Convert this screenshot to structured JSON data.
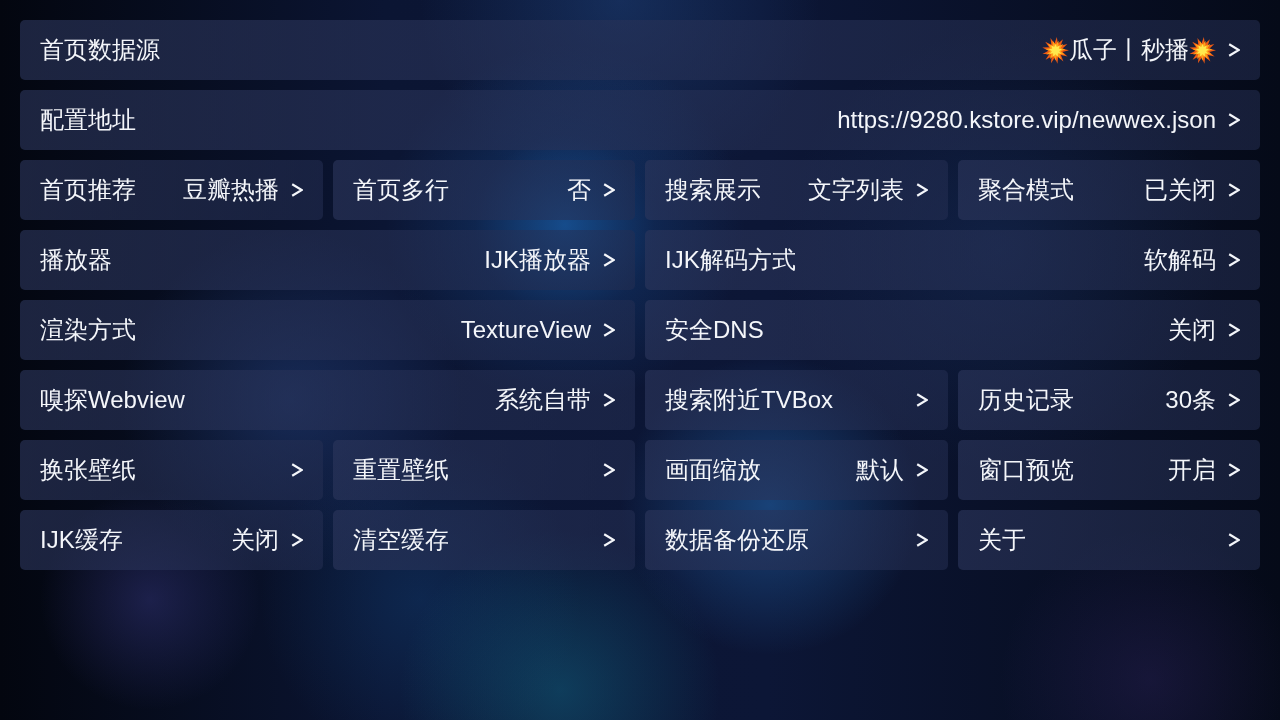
{
  "settings": [
    {
      "label": "首页数据源",
      "value": "瓜子丨秒播",
      "value_icons": true,
      "kind": "full"
    },
    {
      "label": "配置地址",
      "value": "https://9280.kstore.vip/newwex.json",
      "kind": "full"
    },
    {
      "label": "首页推荐",
      "value": "豆瓣热播",
      "kind": "quarter"
    },
    {
      "label": "首页多行",
      "value": "否",
      "kind": "quarter"
    },
    {
      "label": "搜索展示",
      "value": "文字列表",
      "kind": "quarter"
    },
    {
      "label": "聚合模式",
      "value": "已关闭",
      "kind": "quarter"
    },
    {
      "label": "播放器",
      "value": "IJK播放器",
      "kind": "half"
    },
    {
      "label": "IJK解码方式",
      "value": "软解码",
      "kind": "half"
    },
    {
      "label": "渲染方式",
      "value": "TextureView",
      "kind": "half"
    },
    {
      "label": "安全DNS",
      "value": "关闭",
      "kind": "half"
    },
    {
      "label": "嗅探Webview",
      "value": "系统自带",
      "kind": "half"
    },
    {
      "label": "搜索附近TVBox",
      "kind": "quarter"
    },
    {
      "label": "历史记录",
      "value": "30条",
      "kind": "quarter"
    },
    {
      "label": "换张壁纸",
      "kind": "quarter"
    },
    {
      "label": "重置壁纸",
      "kind": "quarter"
    },
    {
      "label": "画面缩放",
      "value": "默认",
      "kind": "quarter"
    },
    {
      "label": "窗口预览",
      "value": "开启",
      "kind": "quarter"
    },
    {
      "label": "IJK缓存",
      "value": "关闭",
      "kind": "quarter"
    },
    {
      "label": "清空缓存",
      "kind": "quarter"
    },
    {
      "label": "数据备份还原",
      "kind": "quarter"
    },
    {
      "label": "关于",
      "kind": "quarter"
    }
  ]
}
